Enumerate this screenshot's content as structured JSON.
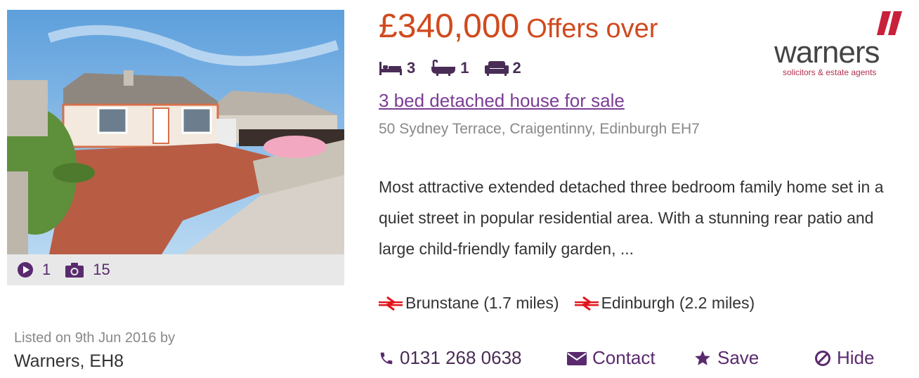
{
  "price": {
    "amount": "£340,000",
    "qualifier": "Offers over"
  },
  "features": [
    {
      "icon": "bed-icon",
      "value": "3"
    },
    {
      "icon": "bath-icon",
      "value": "1"
    },
    {
      "icon": "sofa-icon",
      "value": "2"
    }
  ],
  "listing": {
    "title": "3 bed detached house for sale",
    "address": "50 Sydney Terrace, Craigentinny, Edinburgh EH7",
    "description": "Most attractive extended detached three bedroom family home set in a quiet street in popular residential area. With a stunning rear patio and large child-friendly family garden, ..."
  },
  "stations": [
    {
      "icon": "rail-icon",
      "label": "Brunstane (1.7 miles)"
    },
    {
      "icon": "rail-icon",
      "label": "Edinburgh (2.2 miles)"
    }
  ],
  "media": {
    "videos": "1",
    "photos": "15"
  },
  "listed": {
    "text": "Listed on 9th Jun 2016 by",
    "agent": "Warners, EH8"
  },
  "actions": {
    "phone": "0131 268 0638",
    "contact": "Contact",
    "save": "Save",
    "hide": "Hide"
  },
  "logo": {
    "wordmark": "warners",
    "tagline": "solicitors & estate agents"
  },
  "colors": {
    "price": "#d04a1e",
    "link": "#7b3c95",
    "accent": "#5a2a6e",
    "rail": "#e0161c"
  }
}
